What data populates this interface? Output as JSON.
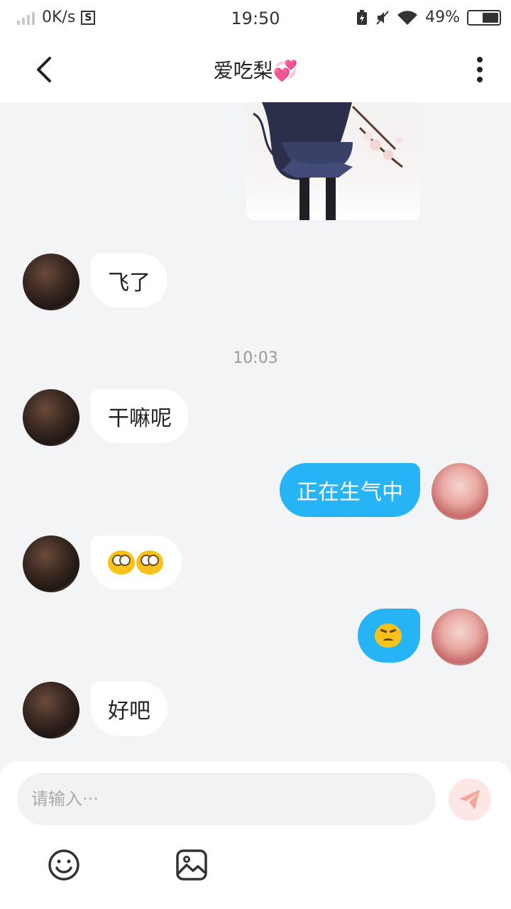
{
  "status_bar": {
    "network_speed": "0K/s",
    "time": "19:50",
    "battery_percent": "49%",
    "battery_level": 0.49
  },
  "header": {
    "title": "爱吃梨💞"
  },
  "messages": [
    {
      "side": "left",
      "text": "飞了"
    },
    {
      "time": "10:03"
    },
    {
      "side": "left",
      "text": "干嘛呢"
    },
    {
      "side": "right",
      "text": "正在生气中"
    },
    {
      "side": "left",
      "emojis": [
        "eye-roll-emoji",
        "eye-roll-emoji"
      ]
    },
    {
      "side": "right",
      "emojis": [
        "angry-emoji"
      ]
    },
    {
      "side": "left",
      "text": "好吧"
    }
  ],
  "input": {
    "placeholder": "请输入···",
    "value": ""
  },
  "colors": {
    "accent": "#27b4f6",
    "send_button_bg": "#fde7e4",
    "send_icon": "#f6a79b",
    "background": "#f3f4f6"
  }
}
